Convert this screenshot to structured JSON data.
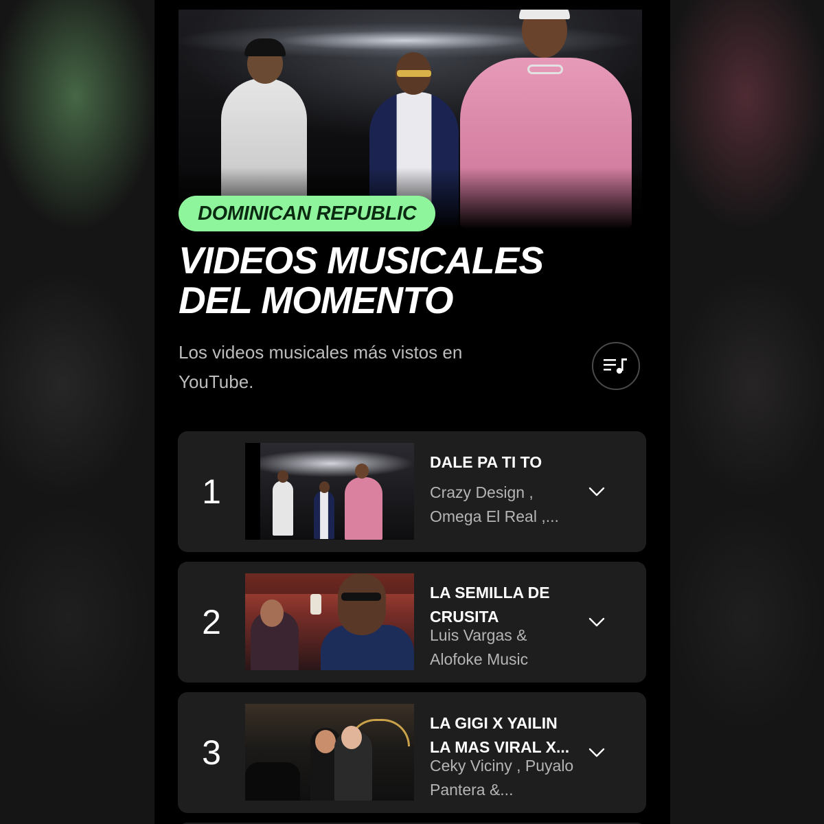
{
  "header": {
    "region": "DOMINICAN REPUBLIC",
    "title": "VIDEOS MUSICALES DEL MOMENTO",
    "subtitle": "Los videos musicales más vistos en YouTube."
  },
  "hero": {
    "image": "three-artists-promo-photo"
  },
  "playlist_button": {
    "icon": "playlist-music-icon"
  },
  "colors": {
    "accent": "#8ff59c",
    "background": "#000000",
    "card": "#1e1e1e",
    "secondary_text": "#b5b5b5"
  },
  "videos": [
    {
      "rank": "1",
      "title": "DALE PA TI TO",
      "artists": "Crazy Design , Omega El Real ,...",
      "expand_icon": "chevron-down-icon"
    },
    {
      "rank": "2",
      "title": "LA SEMILLA DE CRUSITA",
      "artists": "Luis Vargas & Alofoke Music",
      "expand_icon": "chevron-down-icon"
    },
    {
      "rank": "3",
      "title": "LA GIGI X YAILIN LA MAS VIRAL X...",
      "artists": "Ceky Viciny , Puyalo Pantera &...",
      "expand_icon": "chevron-down-icon"
    }
  ]
}
